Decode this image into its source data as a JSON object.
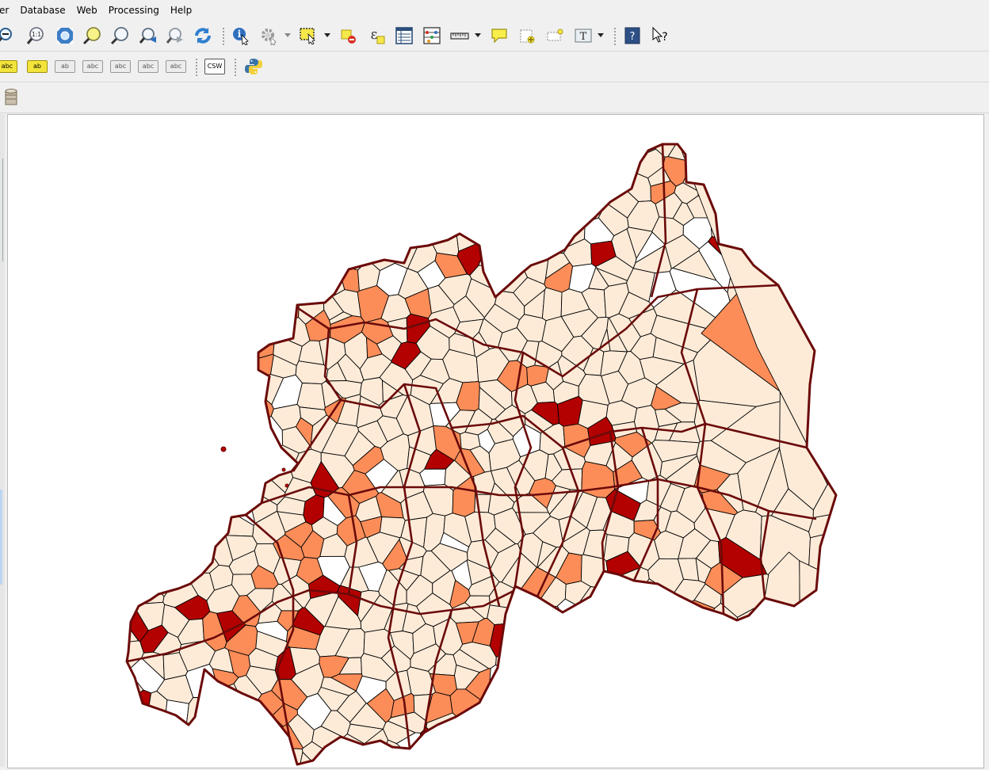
{
  "app": {
    "name": "QGIS"
  },
  "menu": {
    "items": [
      {
        "label": "er"
      },
      {
        "label": "Database"
      },
      {
        "label": "Web"
      },
      {
        "label": "Processing"
      },
      {
        "label": "Help"
      }
    ]
  },
  "toolbar2": {
    "labels": [
      "abc",
      "ab",
      "ab",
      "abc",
      "abc",
      "abc",
      "abc"
    ],
    "csw_label": "CSW"
  },
  "toolbar1": {
    "text_tool_glyph": "T",
    "help_glyph": "?",
    "whats_this_glyph": "?"
  },
  "icons": {
    "zoom-out": "magnifier-minus",
    "zoom-native": "magnifier-1:1",
    "zoom-full": "four-arrows",
    "zoom-selection": "magnifier-yellow",
    "zoom-layer": "magnifier",
    "zoom-last": "magnifier-left",
    "zoom-next": "magnifier-right",
    "refresh": "circular-arrows",
    "identify": "info-cursor",
    "action": "gear",
    "select": "selection-rect",
    "deselect": "deselect",
    "expression-select": "epsilon",
    "attribute-table": "table",
    "field-calc": "abacus",
    "measure": "ruler",
    "map-tips": "speech-bubble",
    "annotation": "new-annotation",
    "python": "python-logo",
    "db-manager": "database"
  },
  "map": {
    "colors": {
      "pale": "#fdebd8",
      "mid": "#fc8d59",
      "dark": "#b30000",
      "none": "#ffffff",
      "boundary": "#6b0a0a",
      "line": "#000000"
    },
    "legend_classes": [
      "none",
      "pale",
      "mid",
      "dark"
    ]
  }
}
